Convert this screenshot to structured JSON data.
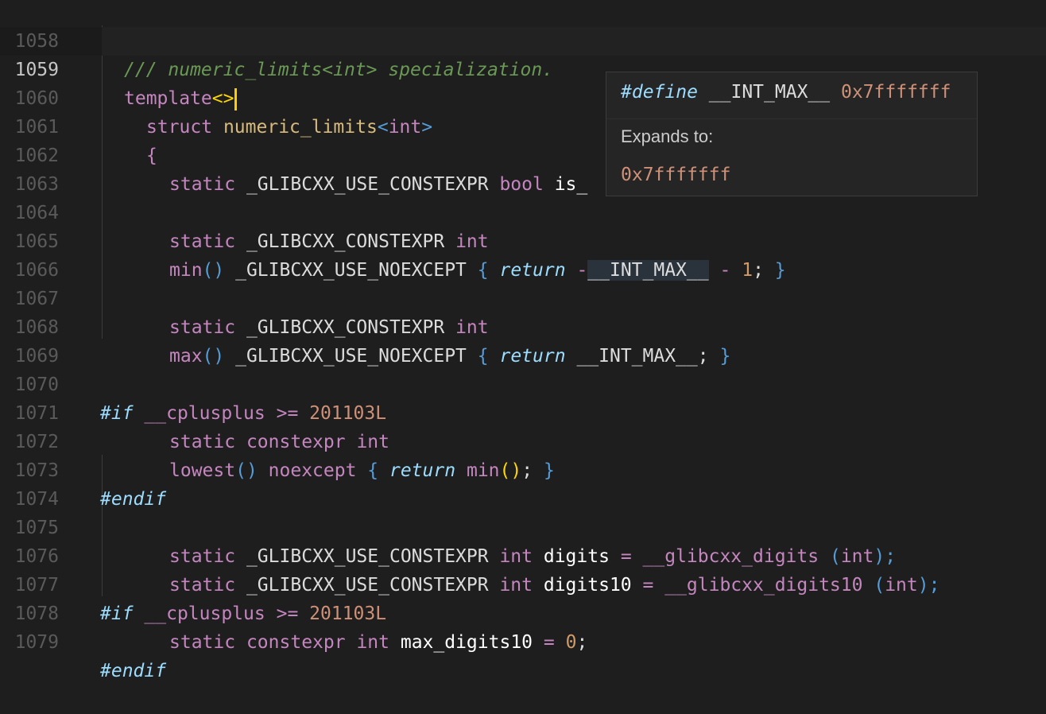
{
  "editor": {
    "current_line": "1059",
    "lines": [
      {
        "n": "1058"
      },
      {
        "n": "1059"
      },
      {
        "n": "1060"
      },
      {
        "n": "1061"
      },
      {
        "n": "1062"
      },
      {
        "n": "1063"
      },
      {
        "n": "1064"
      },
      {
        "n": "1065"
      },
      {
        "n": "1066"
      },
      {
        "n": "1067"
      },
      {
        "n": "1068"
      },
      {
        "n": "1069"
      },
      {
        "n": "1070"
      },
      {
        "n": "1071"
      },
      {
        "n": "1072"
      },
      {
        "n": "1073"
      },
      {
        "n": "1074"
      },
      {
        "n": "1075"
      },
      {
        "n": "1076"
      },
      {
        "n": "1077"
      },
      {
        "n": "1078"
      },
      {
        "n": "1079"
      }
    ],
    "code": {
      "l1058": {
        "comment": "/// numeric_limits<int> specialization."
      },
      "l1059": {
        "kw": "template",
        "br": "<>"
      },
      "l1060": {
        "kw": "struct",
        "type": "numeric_limits",
        "lt": "<",
        "t2": "int",
        "gt": ">"
      },
      "l1061": {
        "brace": "{"
      },
      "l1062": {
        "kw": "static",
        "macro": "_GLIBCXX_USE_CONSTEXPR",
        "t": "bool",
        "id": "is_"
      },
      "l1064": {
        "kw": "static",
        "macro": "_GLIBCXX_CONSTEXPR",
        "t": "int"
      },
      "l1065": {
        "fn": "min",
        "paren": "()",
        "macro": "_GLIBCXX_USE_NOEXCEPT",
        "ob": "{",
        "ret": "return",
        "neg": "-",
        "mac2": "__INT_MAX__",
        "minus": "-",
        "num": "1",
        "semi": ";",
        "cb": "}"
      },
      "l1067": {
        "kw": "static",
        "macro": "_GLIBCXX_CONSTEXPR",
        "t": "int"
      },
      "l1068": {
        "fn": "max",
        "paren": "()",
        "macro": "_GLIBCXX_USE_NOEXCEPT",
        "ob": "{",
        "ret": "return",
        "mac2": "__INT_MAX__",
        "semi": ";",
        "cb": "}"
      },
      "l1070": {
        "pp": "#if",
        "id": "__cplusplus",
        "op": ">=",
        "num": "201103L"
      },
      "l1071": {
        "kw": "static",
        "kw2": "constexpr",
        "t": "int"
      },
      "l1072": {
        "fn": "lowest",
        "paren": "()",
        "kw": "noexcept",
        "ob": "{",
        "ret": "return",
        "fn2": "min",
        "paren2": "()",
        "semi": ";",
        "cb": "}"
      },
      "l1073": {
        "pp": "#endif"
      },
      "l1075": {
        "kw": "static",
        "macro": "_GLIBCXX_USE_CONSTEXPR",
        "t": "int",
        "id": "digits",
        "eq": "=",
        "fn": "__glibcxx_digits",
        "op": "(",
        "t2": "int",
        "cp": ");"
      },
      "l1076": {
        "kw": "static",
        "macro": "_GLIBCXX_USE_CONSTEXPR",
        "t": "int",
        "id": "digits10",
        "eq": "=",
        "fn": "__glibcxx_digits10",
        "op": "(",
        "t2": "int",
        "cp": ");"
      },
      "l1077": {
        "pp": "#if",
        "id": "__cplusplus",
        "op": ">=",
        "num": "201103L"
      },
      "l1078": {
        "kw": "static",
        "kw2": "constexpr",
        "t": "int",
        "id": "max_digits10",
        "eq": "=",
        "num": "0",
        "semi": ";"
      },
      "l1079": {
        "pp": "#endif"
      }
    }
  },
  "hover": {
    "define": "#define",
    "macro": "__INT_MAX__",
    "value": "0x7fffffff",
    "expands_label": "Expands to:",
    "expansion": "0x7fffffff"
  },
  "colors": {
    "background": "#1e1e1e",
    "comment": "#6a9955",
    "keyword": "#c586c0",
    "caret": "#ffcc00",
    "number": "#ce9178"
  }
}
